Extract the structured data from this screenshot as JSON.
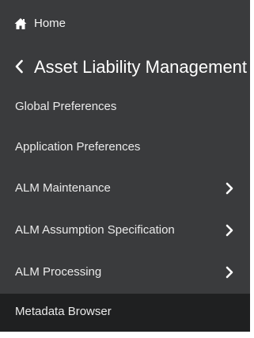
{
  "nav": {
    "home_label": "Home",
    "module_title": "Asset Liability Management",
    "items": [
      {
        "label": "Global Preferences",
        "has_submenu": false
      },
      {
        "label": "Application Preferences",
        "has_submenu": false
      },
      {
        "label": "ALM Maintenance",
        "has_submenu": true
      },
      {
        "label": "ALM Assumption Specification",
        "has_submenu": true
      },
      {
        "label": "ALM Processing",
        "has_submenu": true
      },
      {
        "label": "Metadata Browser",
        "has_submenu": false,
        "selected": true
      }
    ]
  },
  "icons": {
    "home": "home-icon",
    "back": "chevron-left-icon",
    "submenu": "chevron-right-icon"
  },
  "colors": {
    "panel_background": "#3a3b3d",
    "selected_background": "#1f2021",
    "text": "#ffffff"
  }
}
